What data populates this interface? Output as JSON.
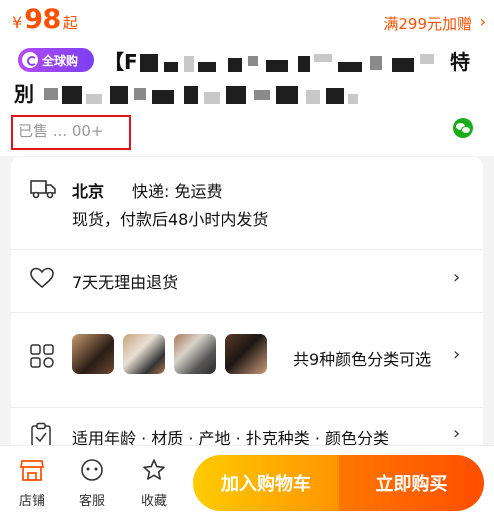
{
  "price": {
    "currency": "¥",
    "amount": "98",
    "suffix": "起"
  },
  "promo": {
    "label": "满299元加赠",
    "arrow": "›"
  },
  "product": {
    "badge_label": "全球购",
    "title_line1_start": "【F",
    "title_line1_end": "特",
    "title_line2_start": "別",
    "sold_text": "已售 ... 00+"
  },
  "share_icon": "wechat-icon",
  "shipping": {
    "city": "北京",
    "method": "快递: 免运费",
    "detail": "现货，付款后48小时内发货"
  },
  "returns": {
    "label": "7天无理由退货",
    "chevron": "›"
  },
  "variants": {
    "summary": "共9种颜色分类可选",
    "chevron": "›",
    "thumb_count": 4
  },
  "attributes": {
    "label": "适用年龄 · 材质 · 产地 · 扑克种类 · 颜色分类",
    "chevron": "›"
  },
  "bottom_bar": {
    "shop_label": "店铺",
    "service_label": "客服",
    "favorite_label": "收藏",
    "add_to_cart": "加入购物车",
    "buy_now": "立即购买"
  },
  "colors": {
    "accent": "#ff5000",
    "cart_gradient": [
      "#ffcb00",
      "#ff9402"
    ],
    "buy_gradient": [
      "#ff7700",
      "#ff4e00"
    ],
    "highlight_box": "#e1151d"
  }
}
